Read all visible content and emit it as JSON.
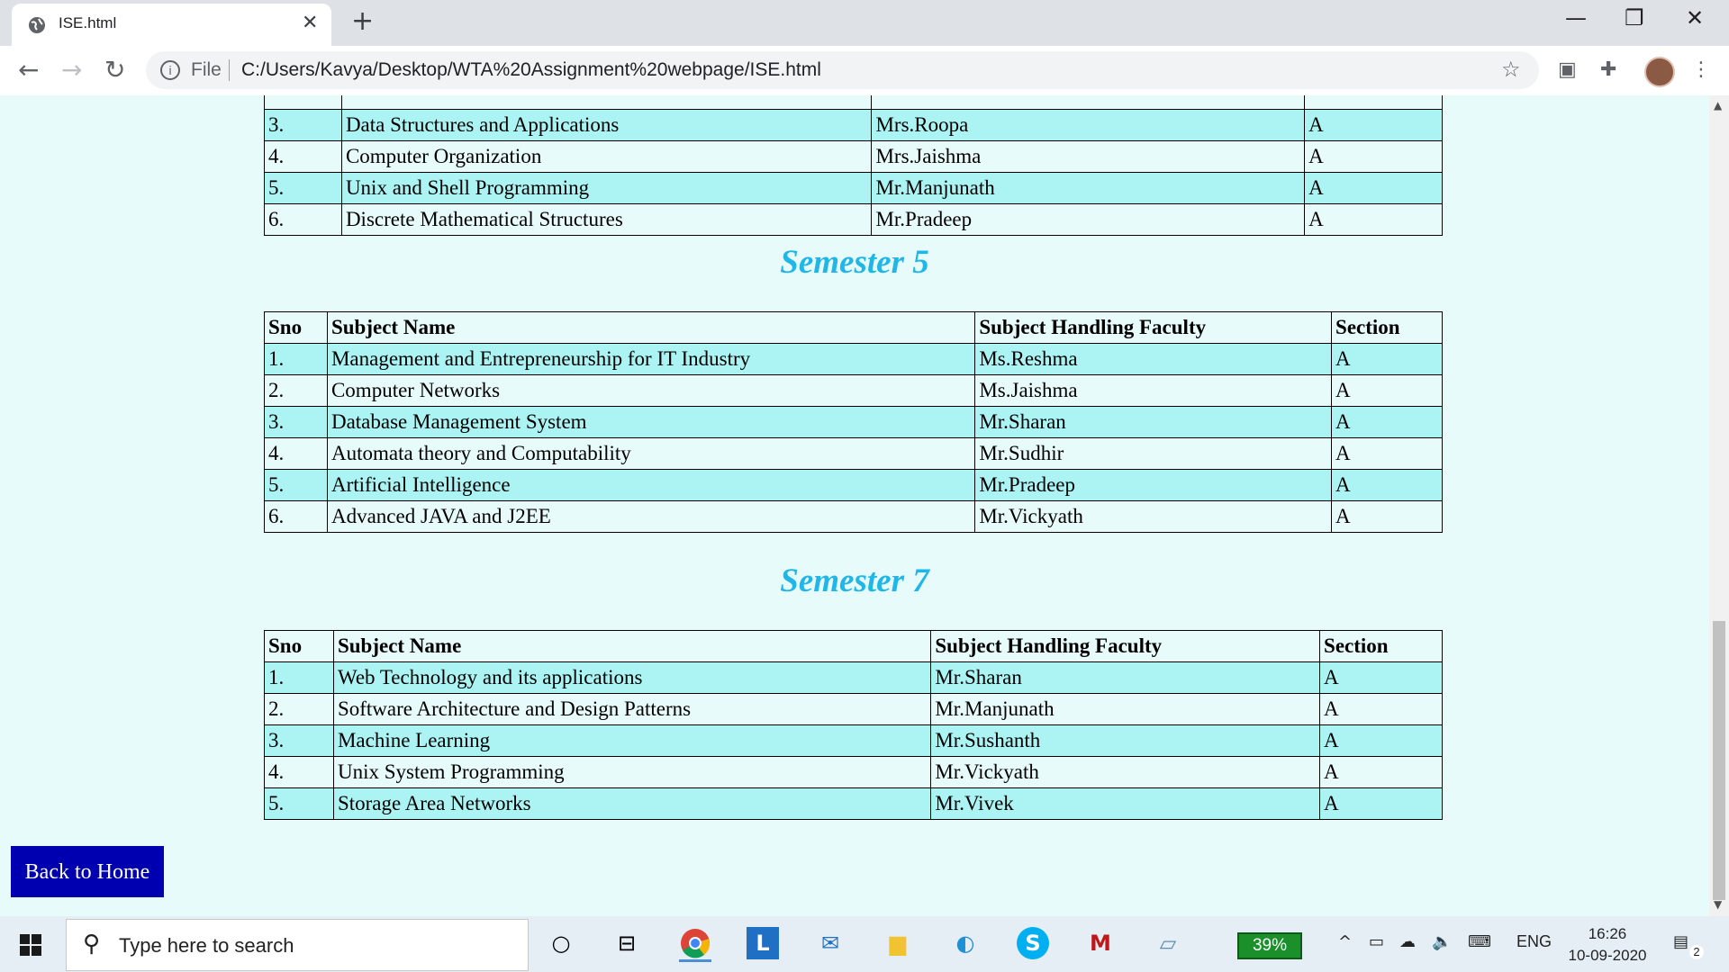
{
  "browser": {
    "tab_title": "ISE.html",
    "address_scheme": "File",
    "address_url": "C:/Users/Kavya/Desktop/WTA%20Assignment%20webpage/ISE.html"
  },
  "headers": {
    "sno": "Sno",
    "subject": "Subject Name",
    "faculty": "Subject Handling Faculty",
    "section": "Section"
  },
  "sem3_rows": [
    {
      "sno": "3.",
      "subject": "Data Structures and Applications",
      "faculty": "Mrs.Roopa",
      "section": "A"
    },
    {
      "sno": "4.",
      "subject": "Computer Organization",
      "faculty": "Mrs.Jaishma",
      "section": "A"
    },
    {
      "sno": "5.",
      "subject": "Unix and Shell Programming",
      "faculty": "Mr.Manjunath",
      "section": "A"
    },
    {
      "sno": "6.",
      "subject": "Discrete Mathematical Structures",
      "faculty": "Mr.Pradeep",
      "section": "A"
    }
  ],
  "sem5": {
    "title": "Semester 5",
    "rows": [
      {
        "sno": "1.",
        "subject": "Management and Entrepreneurship for IT Industry",
        "faculty": "Ms.Reshma",
        "section": "A"
      },
      {
        "sno": "2.",
        "subject": "Computer Networks",
        "faculty": "Ms.Jaishma",
        "section": "A"
      },
      {
        "sno": "3.",
        "subject": "Database Management System",
        "faculty": "Mr.Sharan",
        "section": "A"
      },
      {
        "sno": "4.",
        "subject": "Automata theory and Computability",
        "faculty": "Mr.Sudhir",
        "section": "A"
      },
      {
        "sno": "5.",
        "subject": "Artificial Intelligence",
        "faculty": "Mr.Pradeep",
        "section": "A"
      },
      {
        "sno": "6.",
        "subject": "Advanced JAVA and J2EE",
        "faculty": "Mr.Vickyath",
        "section": "A"
      }
    ]
  },
  "sem7": {
    "title": "Semester 7",
    "rows": [
      {
        "sno": "1.",
        "subject": "Web Technology and its applications",
        "faculty": "Mr.Sharan",
        "section": "A"
      },
      {
        "sno": "2.",
        "subject": "Software Architecture and Design Patterns",
        "faculty": "Mr.Manjunath",
        "section": "A"
      },
      {
        "sno": "3.",
        "subject": "Machine Learning",
        "faculty": "Mr.Sushanth",
        "section": "A"
      },
      {
        "sno": "4.",
        "subject": "Unix System Programming",
        "faculty": "Mr.Vickyath",
        "section": "A"
      },
      {
        "sno": "5.",
        "subject": "Storage Area Networks",
        "faculty": "Mr.Vivek",
        "section": "A"
      }
    ]
  },
  "back_button_label": "Back to Home",
  "taskbar": {
    "search_placeholder": "Type here to search",
    "battery_percent": "39%",
    "language": "ENG",
    "time": "16:26",
    "date": "10-09-2020",
    "notification_count": "2"
  },
  "colors": {
    "row_highlight": "#acf4f4",
    "page_background": "#e8fbfb",
    "semester_title": "#21b6e8",
    "button_background": "#0000b0"
  }
}
